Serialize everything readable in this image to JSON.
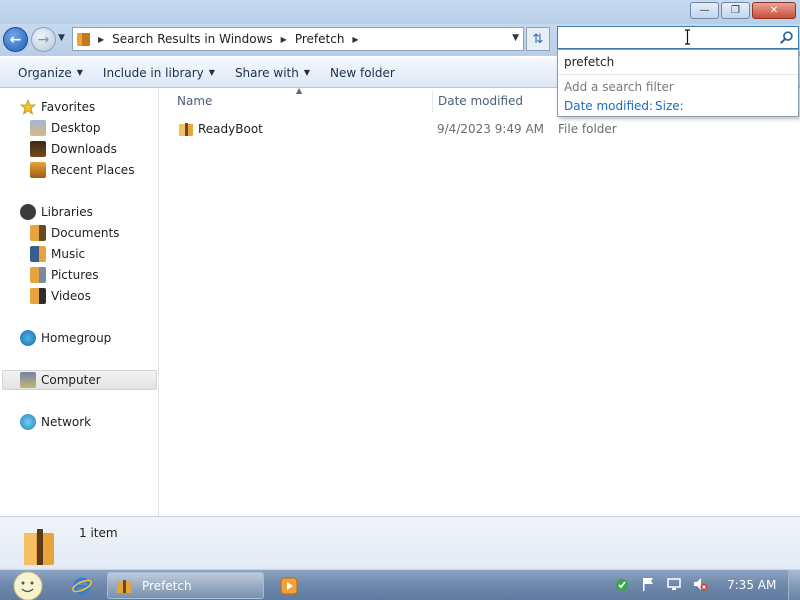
{
  "window": {
    "controls": {
      "minimize": "—",
      "maximize": "❐",
      "close": "✕"
    }
  },
  "address": {
    "crumbs": [
      "Search Results in Windows",
      "Prefetch"
    ]
  },
  "search": {
    "value": "",
    "placeholder": ""
  },
  "search_suggestions": {
    "term": "prefetch",
    "filter_title": "Add a search filter",
    "filters": [
      "Date modified:",
      "Size:"
    ]
  },
  "toolbar": {
    "items": [
      "Organize",
      "Include in library",
      "Share with",
      "New folder"
    ]
  },
  "navigation": {
    "favorites": {
      "label": "Favorites",
      "items": [
        "Desktop",
        "Downloads",
        "Recent Places"
      ]
    },
    "libraries": {
      "label": "Libraries",
      "items": [
        "Documents",
        "Music",
        "Pictures",
        "Videos"
      ]
    },
    "homegroup": "Homegroup",
    "computer": "Computer",
    "network": "Network"
  },
  "columns": {
    "name": "Name",
    "date_modified": "Date modified"
  },
  "files": [
    {
      "name": "ReadyBoot",
      "date": "9/4/2023 9:49 AM",
      "type": "File folder"
    }
  ],
  "details": {
    "count": "1 item"
  },
  "taskbar": {
    "task_label": "Prefetch",
    "clock": "7:35 AM"
  },
  "colors": {
    "accent": "#1b6acb",
    "titlebar": "#c6d9ef",
    "folder": "#e7a43c"
  }
}
